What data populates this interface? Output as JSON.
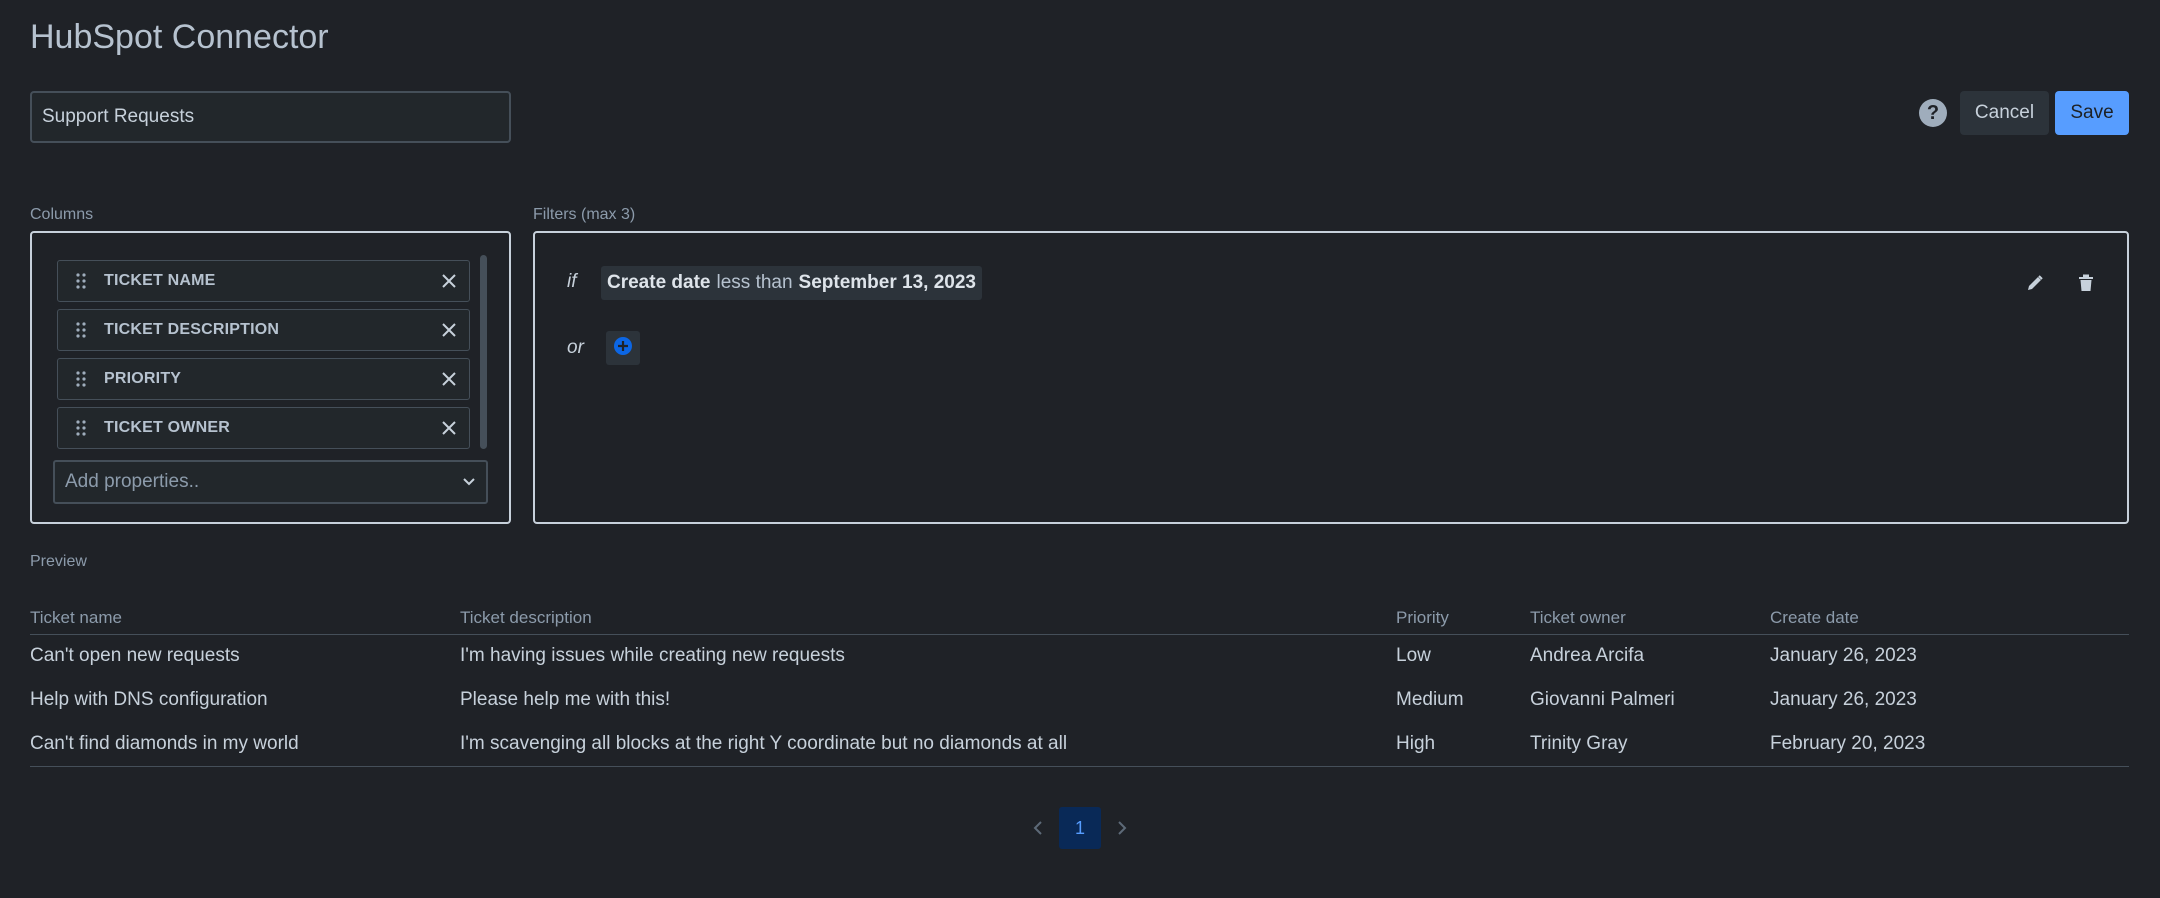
{
  "header": {
    "title": "HubSpot Connector"
  },
  "name_input": {
    "value": "Support Requests"
  },
  "actions": {
    "help_label": "?",
    "cancel_label": "Cancel",
    "save_label": "Save"
  },
  "columns": {
    "label": "Columns",
    "items": [
      {
        "label": "TICKET NAME"
      },
      {
        "label": "TICKET DESCRIPTION"
      },
      {
        "label": "PRIORITY"
      },
      {
        "label": "TICKET OWNER"
      }
    ],
    "add_placeholder": "Add properties.."
  },
  "filters": {
    "label": "Filters (max 3)",
    "if_word": "if",
    "or_word": "or",
    "condition": {
      "field": "Create date",
      "operator": "less than",
      "value": "September 13, 2023"
    }
  },
  "preview": {
    "label": "Preview",
    "headers": [
      "Ticket name",
      "Ticket description",
      "Priority",
      "Ticket owner",
      "Create date"
    ],
    "rows": [
      [
        "Can't open new requests",
        "I'm having issues while creating new requests",
        "Low",
        "Andrea Arcifa",
        "January 26, 2023"
      ],
      [
        "Help with DNS configuration",
        "Please help me with this!",
        "Medium",
        "Giovanni Palmeri",
        "January 26, 2023"
      ],
      [
        "Can't find diamonds in my world",
        "I'm scavenging all blocks at the right Y coordinate but no diamonds at all",
        "High",
        "Trinity Gray",
        "February 20, 2023"
      ]
    ]
  },
  "pagination": {
    "current_page": "1"
  },
  "colors": {
    "background": "#1f2227",
    "accent": "#579dff",
    "page_active_bg": "#092957"
  },
  "icons": [
    "help-icon",
    "drag-handle-icon",
    "close-icon",
    "chevron-down-icon",
    "plus-circle-icon",
    "pencil-icon",
    "trash-icon",
    "chevron-left-icon",
    "chevron-right-icon"
  ]
}
